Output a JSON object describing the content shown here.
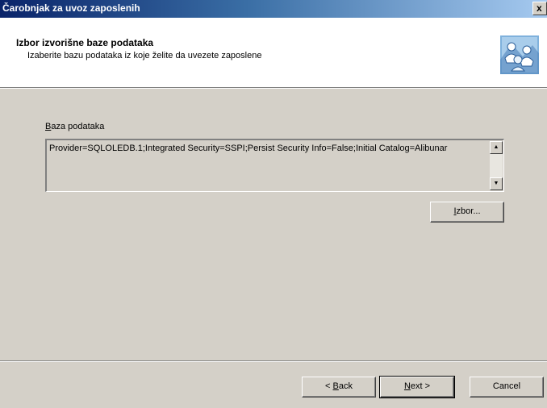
{
  "window": {
    "title": "Čarobnjak za uvoz zaposlenih",
    "close_glyph": "x"
  },
  "header": {
    "title": "Izbor izvorišne baze podataka",
    "subtitle": "Izaberite bazu podataka iz koje želite da uvezete zaposlene",
    "icon": "wizard-people-icon"
  },
  "main": {
    "db_label_accel": "B",
    "db_label_rest": "aza podataka",
    "connection_string": "Provider=SQLOLEDB.1;Integrated Security=SSPI;Persist Security Info=False;Initial Catalog=Alibunar",
    "choose_button_accel": "I",
    "choose_button_rest": "zbor..."
  },
  "footer": {
    "back_prefix": "< ",
    "back_accel": "B",
    "back_rest": "ack",
    "next_accel": "N",
    "next_rest": "ext >",
    "cancel_label": "Cancel"
  },
  "colors": {
    "title_gradient_start": "#0a246a",
    "title_gradient_end": "#a6caf0",
    "dialog_face": "#d4d0c8",
    "header_bg": "#ffffff"
  }
}
